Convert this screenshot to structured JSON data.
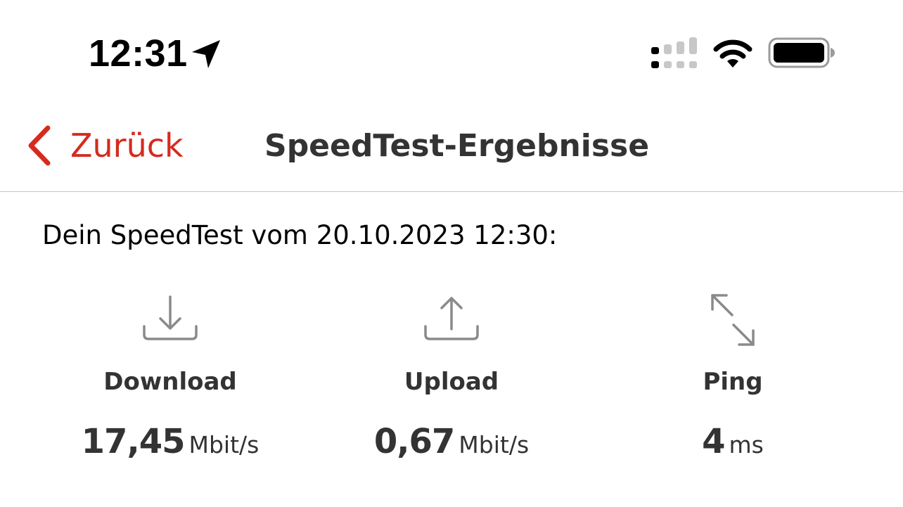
{
  "status_bar": {
    "time": "12:31",
    "location_icon": "location-arrow-icon",
    "signal_icon": "cellular-signal-icon",
    "wifi_icon": "wifi-icon",
    "battery_icon": "battery-icon"
  },
  "nav": {
    "back_label": "Zurück",
    "back_icon": "chevron-left-icon",
    "title": "SpeedTest-Ergebnisse"
  },
  "result": {
    "heading": "Dein SpeedTest vom 20.10.2023 12:30:",
    "download": {
      "icon": "download-icon",
      "label": "Download",
      "value": "17,45",
      "unit": "Mbit/s"
    },
    "upload": {
      "icon": "upload-icon",
      "label": "Upload",
      "value": "0,67",
      "unit": "Mbit/s"
    },
    "ping": {
      "icon": "ping-arrows-icon",
      "label": "Ping",
      "value": "4",
      "unit": "ms"
    }
  },
  "colors": {
    "accent": "#d52b1e",
    "text": "#333333",
    "icon_gray": "#8a8a8a",
    "divider": "#c6c6c6"
  }
}
